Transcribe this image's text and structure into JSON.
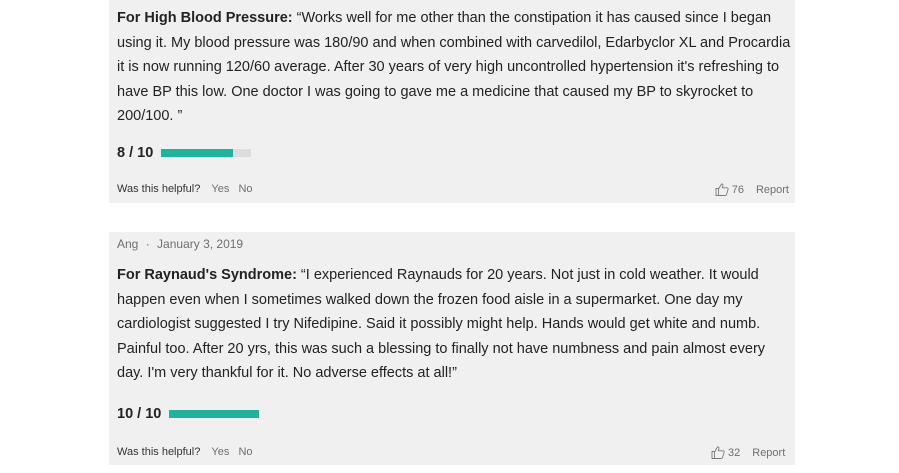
{
  "reviews": [
    {
      "condition": "For High Blood Pressure:",
      "text": " “Works well for me other than the constipation it has caused since I began using it. My blood pressure was 180/90 and when combined with carvedilol, Edarbyclor XL and Procardia it is now running 120/60 average. After 30 years of very high uncontrolled hypertension it's refreshing to have BP this low. One doctor I was going to gave me a medicine that caused my BP to skyrocket to 200/100. ”",
      "rating_label": "8 / 10",
      "rating_fraction": 0.8,
      "helpful_prompt": "Was this helpful?",
      "yes_label": "Yes",
      "no_label": "No",
      "likes": "76",
      "report_label": "Report"
    },
    {
      "author": "Ang",
      "separator": "·",
      "date": "January 3, 2019",
      "condition": "For Raynaud's Syndrome:",
      "text": " “I experienced Raynauds for 20 years. Not just in cold weather. It would happen even when I sometimes walked down the frozen food aisle in a supermarket. One day my cardiologist suggested I try Nifedipine. Said it possibly might help. Hands would get white and numb. Painful too. After 20 yrs, this was such a blessing to finally not have numbness and pain almost every day. I'm very thankful for it. No adverse effects at all!”",
      "rating_label": "10 / 10",
      "rating_fraction": 1.0,
      "helpful_prompt": "Was this helpful?",
      "yes_label": "Yes",
      "no_label": "No",
      "likes": "32",
      "report_label": "Report"
    }
  ],
  "colors": {
    "rating_fill": "#20b29a",
    "rating_track": "#dcdcdc",
    "card_background": "#f0f0f0"
  },
  "icons": {
    "like": "thumbs-up-icon"
  }
}
